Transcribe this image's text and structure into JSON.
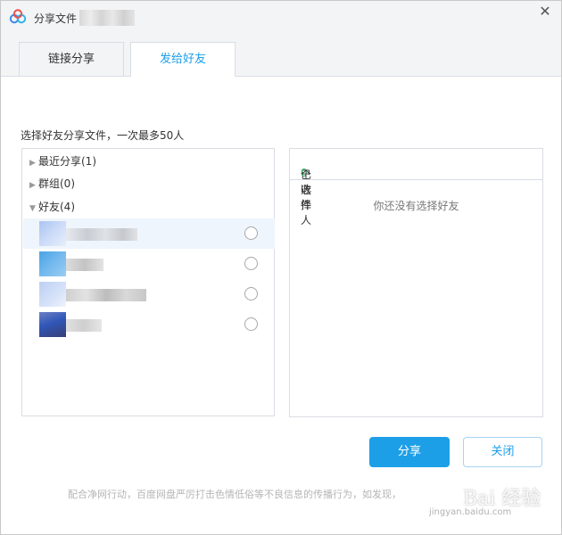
{
  "window": {
    "title": "分享文件",
    "close_glyph": "✕"
  },
  "tabs": [
    {
      "label": "链接分享",
      "active": false
    },
    {
      "label": "发给好友",
      "active": true
    }
  ],
  "hint": "选择好友分享文件，一次最多50人",
  "tree": {
    "recent": "最近分享(1)",
    "groups": "群组(0)",
    "friends": "好友(4)",
    "collapsed_icon": "▶",
    "expanded_icon": "▼"
  },
  "selected": {
    "prefix": "已选择",
    "count": "0",
    "suffix": "个收件人",
    "empty_text": "你还没有选择好友"
  },
  "buttons": {
    "share": "分享",
    "close": "关闭"
  },
  "footer": "配合净网行动，百度网盘严厉打击色情低俗等不良信息的传播行为，如发现，",
  "watermark": {
    "text": "Bai 经验",
    "url": "jingyan.baidu.com"
  },
  "colors": {
    "accent": "#1d9fe8",
    "selected_count": "#27ae60"
  }
}
